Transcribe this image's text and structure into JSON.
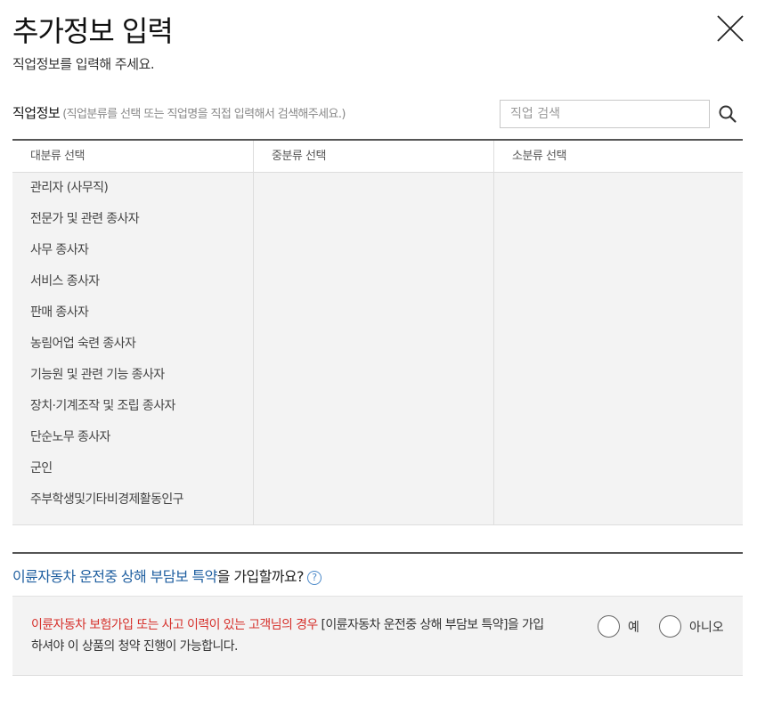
{
  "header": {
    "title": "추가정보 입력",
    "subtitle": "직업정보를 입력해 주세요."
  },
  "job": {
    "label": "직업정보",
    "hint": "(직업분류를 선택 또는 직업명을 직접 입력해서 검색해주세요.)",
    "search_placeholder": "직업 검색"
  },
  "columns": {
    "major": "대분류 선택",
    "middle": "중분류 선택",
    "minor": "소분류 선택"
  },
  "categories": [
    "관리자 (사무직)",
    "전문가 및 관련 종사자",
    "사무 종사자",
    "서비스 종사자",
    "판매 종사자",
    "농림어업 숙련 종사자",
    "기능원 및 관련 기능 종사자",
    "장치·기계조작 및 조립 종사자",
    "단순노무 종사자",
    "군인",
    "주부학생및기타비경제활동인구"
  ],
  "rider": {
    "question_accent": "이륜자동차 운전중 상해 부담보 특약",
    "question_rest": "을 가입할까요?",
    "help": "?",
    "notice_warn": "이륜자동차 보험가입 또는 사고 이력이 있는 고객님의 경우",
    "notice_rest": " [이륜자동차 운전중 상해 부담보 특약]을 가입하셔야 이 상품의 청약 진행이 가능합니다.",
    "option_yes": "예",
    "option_no": "아니오"
  }
}
